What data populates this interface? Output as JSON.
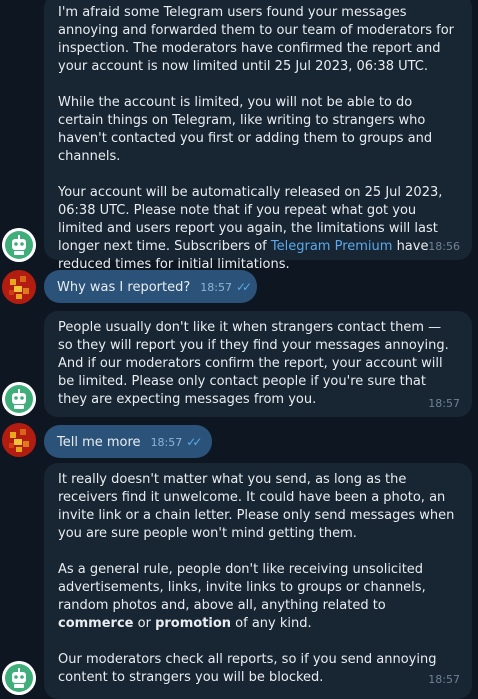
{
  "messages": {
    "m1": {
      "p1": "I'm afraid some Telegram users found your messages annoying and forwarded them to our team of moderators for inspection. The moderators have confirmed the report and your account is now limited until 25 Jul 2023, 06:38 UTC.",
      "p2": "While the account is limited, you will not be able to do certain things on Telegram, like writing to strangers who haven't contacted you first or adding them to groups and channels.",
      "p3_a": "Your account will be automatically released on 25 Jul 2023, 06:38 UTC. Please note that if you repeat what got you limited and users report you again, the limitations will last longer next time. Subscribers of ",
      "p3_link": "Telegram Premium",
      "p3_b": " have reduced times for initial limitations.",
      "time": "18:56"
    },
    "m2": {
      "text": "Why was I reported?",
      "time": "18:57"
    },
    "m3": {
      "text": "People usually don't like it when strangers contact them — so they will report you if they find your messages annoying. And if our moderators confirm the report, your account will be limited. Please only contact people if you're sure that they are expecting messages from you.",
      "time": "18:57"
    },
    "m4": {
      "text": "Tell me more",
      "time": "18:57"
    },
    "m5": {
      "p1": "It really doesn't matter what you send, as long as the receivers find it unwelcome. It could have been a photo, an invite link or a chain letter. Please only send messages when you are sure people won't mind getting them.",
      "p2_a": "As a general rule, people don't like receiving unsolicited advertisements, links, invite links to groups or channels, random photos and, above all, anything related to ",
      "p2_b1": "commerce",
      "p2_mid": " or ",
      "p2_b2": "promotion",
      "p2_c": " of any kind.",
      "p3": "Our moderators check all reports, so if you send annoying content to strangers you will be blocked.",
      "time": "18:57"
    }
  },
  "colors": {
    "background": "#0e1621",
    "incoming_bubble": "#182533",
    "outgoing_bubble": "#2b5278",
    "link": "#5aa9ea",
    "bot_avatar": "#3fae7a",
    "user_avatar": "#b31c10"
  },
  "icons": {
    "bot": "robot-icon",
    "user": "pixel-avatar-icon",
    "read": "double-check-icon"
  }
}
